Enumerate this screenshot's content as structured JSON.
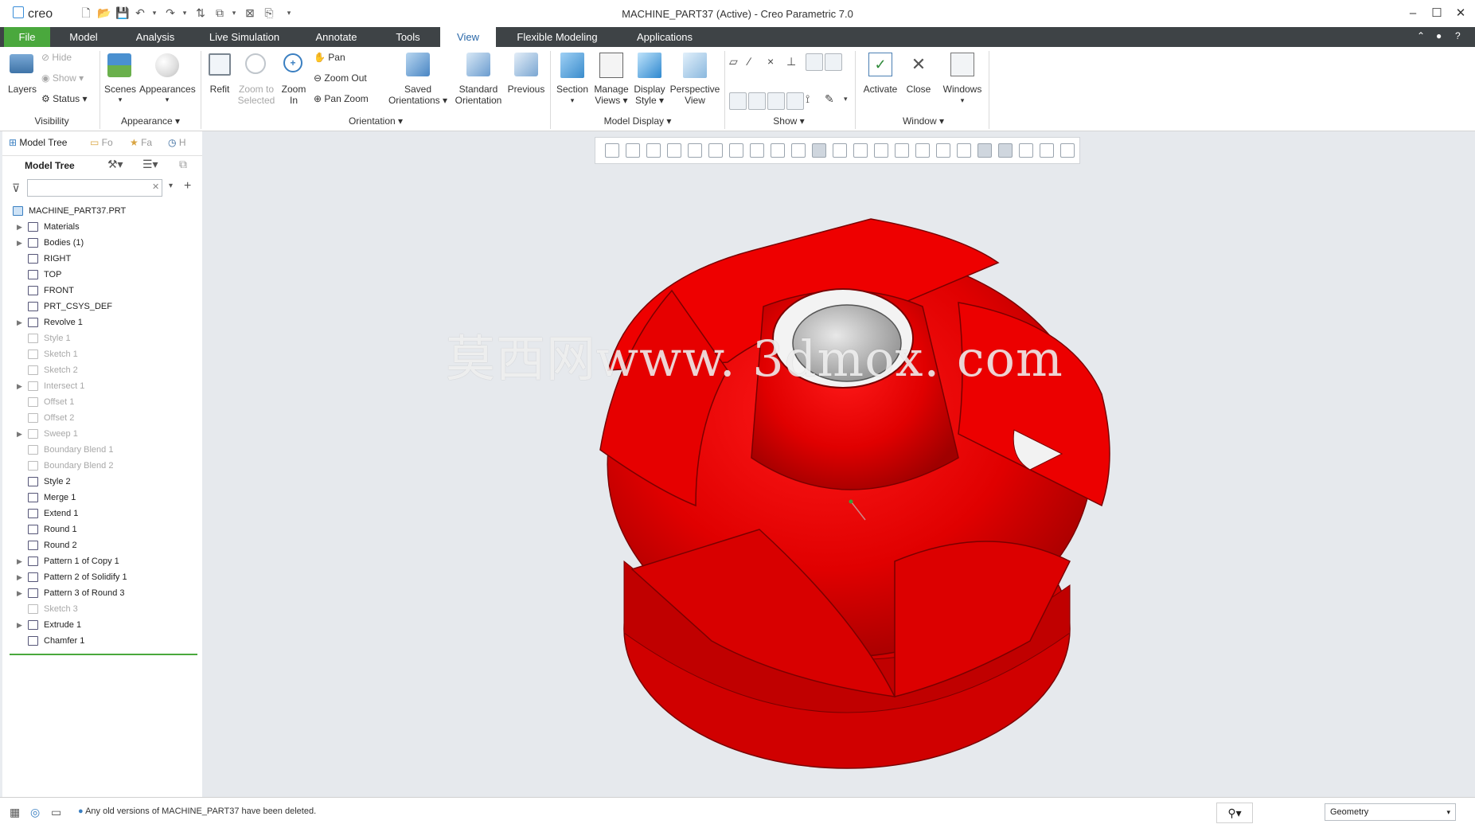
{
  "app": {
    "logo_text": "creo",
    "window_title": "MACHINE_PART37 (Active) - Creo Parametric 7.0",
    "window_controls": {
      "minimize": "–",
      "maximize": "☐",
      "close": "✕"
    }
  },
  "menu": {
    "tabs": [
      "File",
      "Model",
      "Analysis",
      "Live Simulation",
      "Annotate",
      "Tools",
      "View",
      "Flexible Modeling",
      "Applications"
    ],
    "active_tab": "View"
  },
  "ribbon": {
    "visibility": {
      "layers": "Layers",
      "hide": "Hide",
      "show": "Show",
      "status": "Status",
      "group": "Visibility"
    },
    "appearance": {
      "scenes": "Scenes",
      "appearances": "Appearances",
      "group": "Appearance"
    },
    "orientation": {
      "refit": "Refit",
      "zoom_to_selected_1": "Zoom to",
      "zoom_to_selected_2": "Selected",
      "zoom_in_1": "Zoom",
      "zoom_in_2": "In",
      "pan": "Pan",
      "zoom_out": "Zoom Out",
      "pan_zoom": "Pan Zoom",
      "saved_1": "Saved",
      "saved_2": "Orientations",
      "standard_1": "Standard",
      "standard_2": "Orientation",
      "previous": "Previous",
      "group": "Orientation"
    },
    "model_display": {
      "section": "Section",
      "manage_1": "Manage",
      "manage_2": "Views",
      "display_1": "Display",
      "display_2": "Style",
      "perspective_1": "Perspective",
      "perspective_2": "View",
      "group": "Model Display"
    },
    "show": {
      "group": "Show"
    },
    "window": {
      "activate": "Activate",
      "close": "Close",
      "windows": "Windows",
      "group": "Window"
    }
  },
  "left_panel": {
    "tabs": {
      "model_tree": "Model Tree",
      "folder": "Fo",
      "favorites": "Fa",
      "history": "H"
    },
    "tree_header": "Model Tree",
    "search_placeholder": "",
    "root": "MACHINE_PART37.PRT",
    "items": [
      {
        "label": "Materials",
        "expandable": true,
        "dim": false
      },
      {
        "label": "Bodies (1)",
        "expandable": true,
        "dim": false
      },
      {
        "label": "RIGHT",
        "expandable": false,
        "dim": false
      },
      {
        "label": "TOP",
        "expandable": false,
        "dim": false
      },
      {
        "label": "FRONT",
        "expandable": false,
        "dim": false
      },
      {
        "label": "PRT_CSYS_DEF",
        "expandable": false,
        "dim": false
      },
      {
        "label": "Revolve 1",
        "expandable": true,
        "dim": false
      },
      {
        "label": "Style 1",
        "expandable": false,
        "dim": true
      },
      {
        "label": "Sketch 1",
        "expandable": false,
        "dim": true
      },
      {
        "label": "Sketch 2",
        "expandable": false,
        "dim": true
      },
      {
        "label": "Intersect 1",
        "expandable": true,
        "dim": true
      },
      {
        "label": "Offset 1",
        "expandable": false,
        "dim": true
      },
      {
        "label": "Offset 2",
        "expandable": false,
        "dim": true
      },
      {
        "label": "Sweep 1",
        "expandable": true,
        "dim": true
      },
      {
        "label": "Boundary Blend 1",
        "expandable": false,
        "dim": true
      },
      {
        "label": "Boundary Blend 2",
        "expandable": false,
        "dim": true
      },
      {
        "label": "Style 2",
        "expandable": false,
        "dim": false
      },
      {
        "label": "Merge 1",
        "expandable": false,
        "dim": false
      },
      {
        "label": "Extend 1",
        "expandable": false,
        "dim": false
      },
      {
        "label": "Round 1",
        "expandable": false,
        "dim": false
      },
      {
        "label": "Round 2",
        "expandable": false,
        "dim": false
      },
      {
        "label": "Pattern 1 of Copy 1",
        "expandable": true,
        "dim": false
      },
      {
        "label": "Pattern 2 of Solidify 1",
        "expandable": true,
        "dim": false
      },
      {
        "label": "Pattern 3 of Round 3",
        "expandable": true,
        "dim": false
      },
      {
        "label": "Sketch 3",
        "expandable": false,
        "dim": true
      },
      {
        "label": "Extrude 1",
        "expandable": true,
        "dim": false
      },
      {
        "label": "Chamfer 1",
        "expandable": false,
        "dim": false
      }
    ]
  },
  "viewport": {
    "watermark": "莫西网www. 3dmox. com",
    "model_color": "#e30000"
  },
  "status": {
    "message": "Any old versions of MACHINE_PART37 have been deleted.",
    "filter": "Geometry"
  },
  "colors": {
    "file_tab": "#4aa83d",
    "menubar": "#3e4346",
    "active_tab_text": "#2a68a8"
  }
}
